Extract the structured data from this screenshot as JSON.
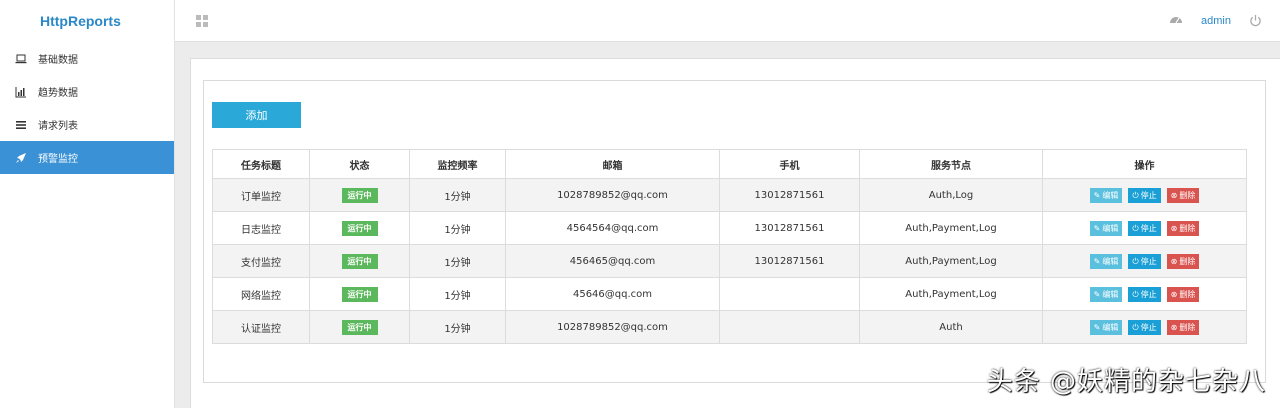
{
  "brand": "HttpReports",
  "header": {
    "user": "admin"
  },
  "sidebar": {
    "items": [
      {
        "label": "基础数据"
      },
      {
        "label": "趋势数据"
      },
      {
        "label": "请求列表"
      },
      {
        "label": "预警监控"
      }
    ]
  },
  "main": {
    "add_label": "添加",
    "columns": [
      "任务标题",
      "状态",
      "监控频率",
      "邮箱",
      "手机",
      "服务节点",
      "操作"
    ],
    "rows": [
      {
        "title": "订单监控",
        "status": "运行中",
        "freq": "1分钟",
        "email": "1028789852@qq.com",
        "phone": "13012871561",
        "nodes": "Auth,Log"
      },
      {
        "title": "日志监控",
        "status": "运行中",
        "freq": "1分钟",
        "email": "4564564@qq.com",
        "phone": "13012871561",
        "nodes": "Auth,Payment,Log"
      },
      {
        "title": "支付监控",
        "status": "运行中",
        "freq": "1分钟",
        "email": "456465@qq.com",
        "phone": "13012871561",
        "nodes": "Auth,Payment,Log"
      },
      {
        "title": "网络监控",
        "status": "运行中",
        "freq": "1分钟",
        "email": "45646@qq.com",
        "phone": "",
        "nodes": "Auth,Payment,Log"
      },
      {
        "title": "认证监控",
        "status": "运行中",
        "freq": "1分钟",
        "email": "1028789852@qq.com",
        "phone": "",
        "nodes": "Auth"
      }
    ],
    "actions": {
      "edit": "编辑",
      "stop": "停止",
      "delete": "删除"
    }
  },
  "watermark": "头条 @妖精的杂七杂八",
  "colors": {
    "brand": "#2a88c8",
    "active": "#3a91d6",
    "add": "#2aa9d9",
    "running": "#5cb85c",
    "edit": "#5bc0de",
    "stop": "#1a9fd6",
    "delete": "#d9534f"
  },
  "icons": {
    "nav": [
      "laptop-icon",
      "bar-chart-icon",
      "list-icon",
      "rocket-icon"
    ],
    "header": [
      "grid-icon",
      "dashboard-icon",
      "power-icon"
    ]
  }
}
